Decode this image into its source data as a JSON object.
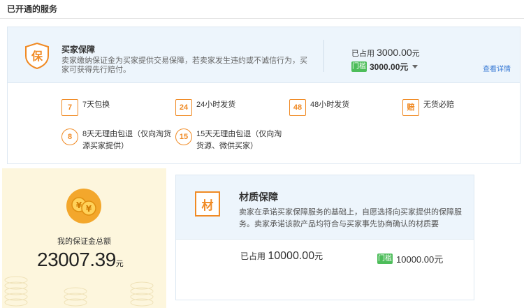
{
  "section_title": "已开通的服务",
  "buyer_protection": {
    "icon_char": "保",
    "title": "买家保障",
    "description": "卖家缴纳保证金为买家提供交易保障，若卖家发生违约或不诚信行为，买家可获得先行赔付。",
    "used_label": "已占用",
    "used_amount": "3000.00",
    "unit": "元",
    "men_tag": "门槛",
    "men_amount": "3000.00元",
    "detail_link": "查看详情",
    "features": [
      {
        "icon": "7",
        "icon_name": "seven-day-exchange-icon",
        "label": "7天包换"
      },
      {
        "icon": "24",
        "icon_name": "24h-shipping-icon",
        "label": "24小时发货"
      },
      {
        "icon": "48",
        "icon_name": "48h-shipping-icon",
        "label": "48小时发货"
      },
      {
        "icon": "赔",
        "icon_name": "compensation-icon",
        "label": "无货必赔"
      },
      {
        "icon": "8",
        "icon_name": "eight-day-return-icon",
        "label": "8天无理由包退（仅向淘货源买家提供）"
      },
      {
        "icon": "15",
        "icon_name": "fifteen-day-return-icon",
        "label": "15天无理由包退（仅向淘货源、微供买家）"
      }
    ]
  },
  "deposit": {
    "label": "我的保证金总额",
    "amount": "23007.39",
    "unit": "元"
  },
  "material": {
    "icon_char": "材",
    "title": "材质保障",
    "description": "卖家在承诺买家保障服务的基础上，自愿选择向买家提供的保障服务。卖家承诺该款产品均符合与买家事先协商确认的材质要",
    "used_label": "已占用",
    "used_amount": "10000.00",
    "unit": "元",
    "men_tag": "门槛",
    "men_amount": "10000.00元"
  },
  "colors": {
    "accent_orange": "#f08a24",
    "link_blue": "#3a7bd5",
    "tag_green": "#4dbd5a",
    "header_blue_bg": "#edf5fc",
    "deposit_bg": "#fdf6dd"
  }
}
